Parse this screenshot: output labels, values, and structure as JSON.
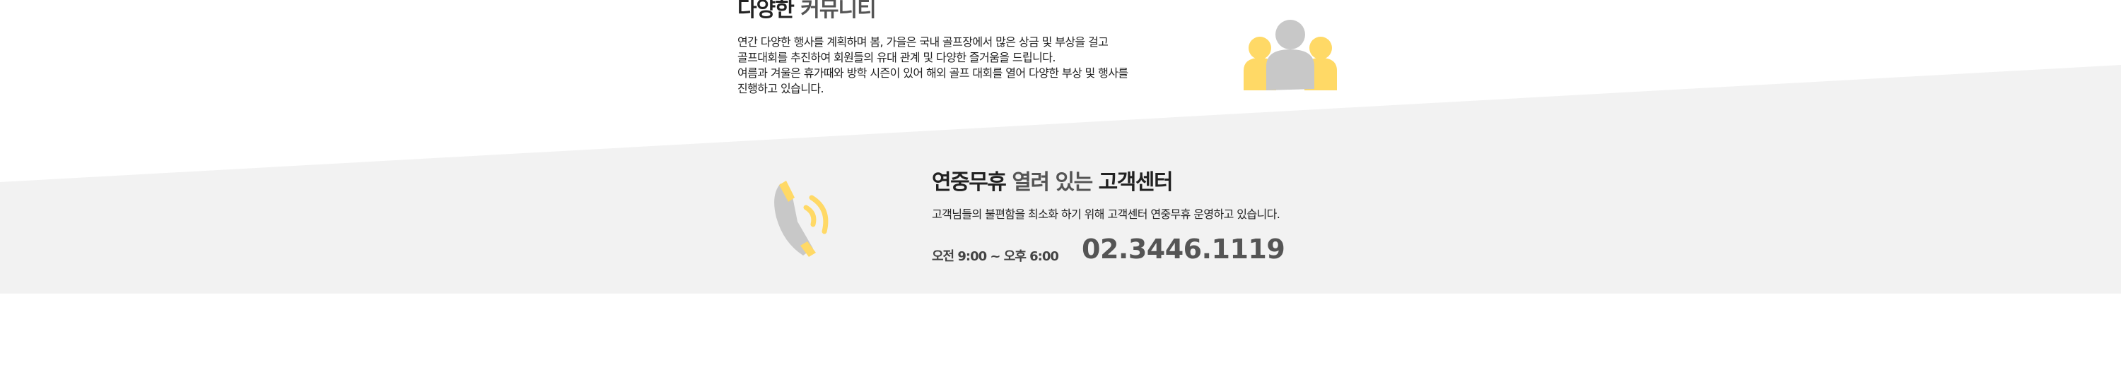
{
  "community": {
    "title_bold": "다양한",
    "title_light": "커뮤니티",
    "description": [
      "연간 다양한 행사를 계획하며 봄, 가을은 국내 골프장에서 많은 상금 및 부상을 걸고",
      "골프대회를 추진하여 회원들의 유대 관계 및 다양한 즐거움을 드립니다.",
      "여름과 겨울은 휴가때와 방학 시즌이 있어 해외 골프 대회를 열어 다양한 부상 및 행사를",
      "진행하고 있습니다."
    ],
    "icon": "people-group-icon"
  },
  "customer_center": {
    "title_part1": "연중무휴",
    "title_part2": "열려 있는",
    "title_part3": "고객센터",
    "description": "고객님들의 불편함을 최소화 하기 위해 고객센터 연중무휴 운영하고 있습니다.",
    "hours": "오전 9:00 ~ 오후 6:00",
    "phone": "02.3446.1119",
    "icon": "phone-icon"
  },
  "colors": {
    "accent_yellow": "#ffd966",
    "icon_gray": "#c8c8c8",
    "band_gray": "#f2f2f2",
    "text_dark": "#222222"
  }
}
